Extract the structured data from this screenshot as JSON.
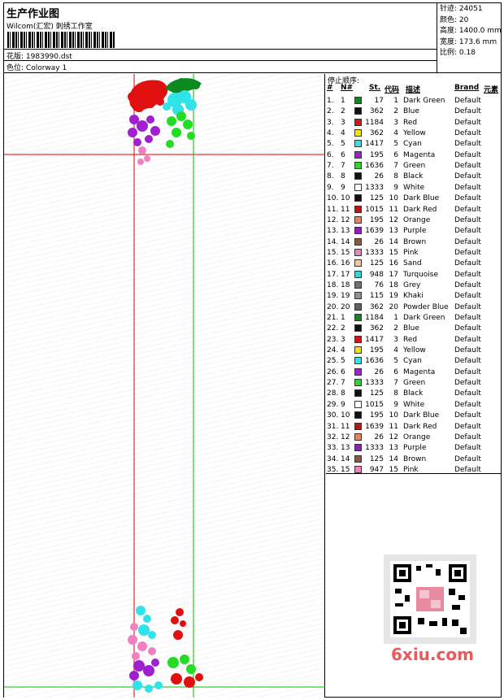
{
  "header": {
    "title": "生产作业图",
    "company": "Wilcom(汇宏) 刺绣工作室",
    "design_label": "花版:",
    "design_value": "1983990.dst",
    "colorway_label": "色位:",
    "colorway_value": "Colorway 1",
    "stats": [
      {
        "label": "针迹:",
        "value": "24051"
      },
      {
        "label": "颜色:",
        "value": "20"
      },
      {
        "label": "高度:",
        "value": "1400.0 mm"
      },
      {
        "label": "宽度:",
        "value": "173.6 mm"
      },
      {
        "label": "比例:",
        "value": "0.18"
      }
    ]
  },
  "stops": {
    "title": "停止顺序:",
    "headers": {
      "idx": "#",
      "need": "N#",
      "st": "St.",
      "code": "代码",
      "desc": "描述",
      "brand": "Brand",
      "elem": "元素"
    },
    "rows": [
      {
        "idx": "1.",
        "need": "1",
        "color": "#0b8a1f",
        "st": "17",
        "code": "1",
        "desc": "Dark Green",
        "brand": "Default"
      },
      {
        "idx": "2.",
        "need": "2",
        "color": "#111111",
        "st": "362",
        "code": "2",
        "desc": "Blue",
        "brand": "Default"
      },
      {
        "idx": "3.",
        "need": "3",
        "color": "#e01010",
        "st": "1184",
        "code": "3",
        "desc": "Red",
        "brand": "Default"
      },
      {
        "idx": "4.",
        "need": "4",
        "color": "#f5e400",
        "st": "362",
        "code": "4",
        "desc": "Yellow",
        "brand": "Default"
      },
      {
        "idx": "5.",
        "need": "5",
        "color": "#2fe3e8",
        "st": "1417",
        "code": "5",
        "desc": "Cyan",
        "brand": "Default"
      },
      {
        "idx": "6.",
        "need": "6",
        "color": "#a020d0",
        "st": "195",
        "code": "6",
        "desc": "Magenta",
        "brand": "Default"
      },
      {
        "idx": "7.",
        "need": "7",
        "color": "#22dd22",
        "st": "1636",
        "code": "7",
        "desc": "Green",
        "brand": "Default"
      },
      {
        "idx": "8.",
        "need": "8",
        "color": "#111111",
        "st": "26",
        "code": "8",
        "desc": "Black",
        "brand": "Default"
      },
      {
        "idx": "9.",
        "need": "9",
        "color": "#ffffff",
        "st": "1333",
        "code": "9",
        "desc": "White",
        "brand": "Default"
      },
      {
        "idx": "10.",
        "need": "10",
        "color": "#111111",
        "st": "125",
        "code": "10",
        "desc": "Dark Blue",
        "brand": "Default"
      },
      {
        "idx": "11.",
        "need": "11",
        "color": "#c81010",
        "st": "1015",
        "code": "11",
        "desc": "Dark Red",
        "brand": "Default"
      },
      {
        "idx": "12.",
        "need": "12",
        "color": "#f08060",
        "st": "195",
        "code": "12",
        "desc": "Orange",
        "brand": "Default"
      },
      {
        "idx": "13.",
        "need": "13",
        "color": "#9a18c8",
        "st": "1639",
        "code": "13",
        "desc": "Purple",
        "brand": "Default"
      },
      {
        "idx": "14.",
        "need": "14",
        "color": "#8a5a3a",
        "st": "26",
        "code": "14",
        "desc": "Brown",
        "brand": "Default"
      },
      {
        "idx": "15.",
        "need": "15",
        "color": "#f080c0",
        "st": "1333",
        "code": "15",
        "desc": "Pink",
        "brand": "Default"
      },
      {
        "idx": "16.",
        "need": "16",
        "color": "#f0c8a0",
        "st": "125",
        "code": "16",
        "desc": "Sand",
        "brand": "Default"
      },
      {
        "idx": "17.",
        "need": "17",
        "color": "#20e0d8",
        "st": "948",
        "code": "17",
        "desc": "Turquoise",
        "brand": "Default"
      },
      {
        "idx": "18.",
        "need": "18",
        "color": "#707070",
        "st": "76",
        "code": "18",
        "desc": "Grey",
        "brand": "Default"
      },
      {
        "idx": "19.",
        "need": "19",
        "color": "#909090",
        "st": "115",
        "code": "19",
        "desc": "Khaki",
        "brand": "Default"
      },
      {
        "idx": "20.",
        "need": "20",
        "color": "#606060",
        "st": "362",
        "code": "20",
        "desc": "Powder Blue",
        "brand": "Default"
      },
      {
        "idx": "21.",
        "need": "1",
        "color": "#0b8a1f",
        "st": "1184",
        "code": "1",
        "desc": "Dark Green",
        "brand": "Default"
      },
      {
        "idx": "22.",
        "need": "2",
        "color": "#111111",
        "st": "362",
        "code": "2",
        "desc": "Blue",
        "brand": "Default"
      },
      {
        "idx": "23.",
        "need": "3",
        "color": "#e01010",
        "st": "1417",
        "code": "3",
        "desc": "Red",
        "brand": "Default"
      },
      {
        "idx": "24.",
        "need": "4",
        "color": "#f5e400",
        "st": "195",
        "code": "4",
        "desc": "Yellow",
        "brand": "Default"
      },
      {
        "idx": "25.",
        "need": "5",
        "color": "#2fe3e8",
        "st": "1636",
        "code": "5",
        "desc": "Cyan",
        "brand": "Default"
      },
      {
        "idx": "26.",
        "need": "6",
        "color": "#a020d0",
        "st": "26",
        "code": "6",
        "desc": "Magenta",
        "brand": "Default"
      },
      {
        "idx": "27.",
        "need": "7",
        "color": "#22dd22",
        "st": "1333",
        "code": "7",
        "desc": "Green",
        "brand": "Default"
      },
      {
        "idx": "28.",
        "need": "8",
        "color": "#111111",
        "st": "125",
        "code": "8",
        "desc": "Black",
        "brand": "Default"
      },
      {
        "idx": "29.",
        "need": "9",
        "color": "#ffffff",
        "st": "1015",
        "code": "9",
        "desc": "White",
        "brand": "Default"
      },
      {
        "idx": "30.",
        "need": "10",
        "color": "#111111",
        "st": "195",
        "code": "10",
        "desc": "Dark Blue",
        "brand": "Default"
      },
      {
        "idx": "31.",
        "need": "11",
        "color": "#c81010",
        "st": "1639",
        "code": "11",
        "desc": "Dark Red",
        "brand": "Default"
      },
      {
        "idx": "32.",
        "need": "12",
        "color": "#f08060",
        "st": "26",
        "code": "12",
        "desc": "Orange",
        "brand": "Default"
      },
      {
        "idx": "33.",
        "need": "13",
        "color": "#9a18c8",
        "st": "1333",
        "code": "13",
        "desc": "Purple",
        "brand": "Default"
      },
      {
        "idx": "34.",
        "need": "14",
        "color": "#8a5a3a",
        "st": "125",
        "code": "14",
        "desc": "Brown",
        "brand": "Default"
      },
      {
        "idx": "35.",
        "need": "15",
        "color": "#f080c0",
        "st": "947",
        "code": "15",
        "desc": "Pink",
        "brand": "Default"
      }
    ]
  },
  "watermark": {
    "text": "6xiu.com",
    "color": "#e85a5a"
  },
  "guides": {
    "red": "#e00000",
    "green": "#00c000"
  }
}
